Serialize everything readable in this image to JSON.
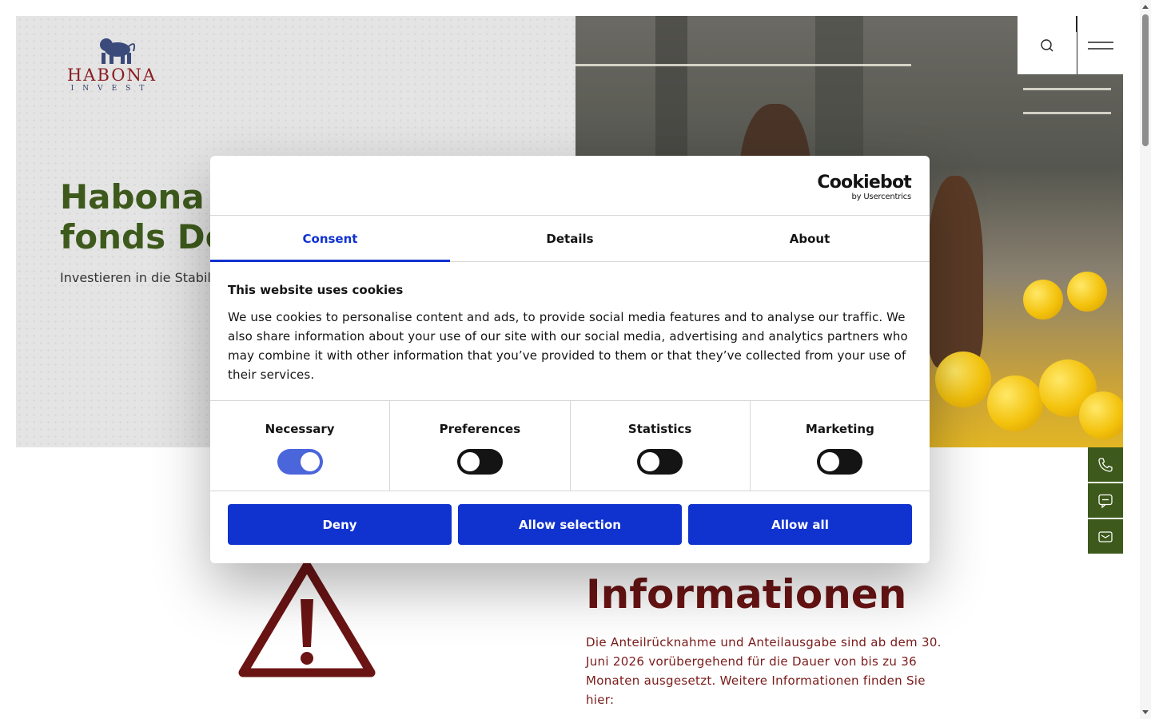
{
  "brand": {
    "logo_word": "HABONA",
    "logo_sub": "INVEST"
  },
  "hero": {
    "title": "Habona N\nfonds De",
    "subtitle": "Investieren in die Stabilit"
  },
  "header": {
    "search_icon": "search-icon",
    "menu_icon": "hamburger-menu-icon"
  },
  "side_actions": [
    {
      "icon": "phone-icon"
    },
    {
      "icon": "chat-icon"
    },
    {
      "icon": "mail-icon"
    }
  ],
  "info": {
    "title_line2": "Informationen",
    "text": "Die Anteilrücknahme und Anteilausgabe sind ab dem 30. Juni 2026 vorübergehend für die Dauer von bis zu 36 Monaten ausgesetzt. Weitere Informationen finden Sie hier:"
  },
  "cookie_dialog": {
    "provider_name": "Cookiebot",
    "provider_by": "by Usercentrics",
    "tabs": [
      {
        "label": "Consent",
        "active": true
      },
      {
        "label": "Details",
        "active": false
      },
      {
        "label": "About",
        "active": false
      }
    ],
    "heading": "This website uses cookies",
    "body": "We use cookies to personalise content and ads, to provide social media features and to analyse our traffic. We also share information about your use of our site with our social media, advertising and analytics partners who may combine it with other information that you’ve provided to them or that they’ve collected from your use of their services.",
    "categories": [
      {
        "label": "Necessary",
        "checked": true
      },
      {
        "label": "Preferences",
        "checked": false
      },
      {
        "label": "Statistics",
        "checked": false
      },
      {
        "label": "Marketing",
        "checked": false
      }
    ],
    "buttons": {
      "deny": "Deny",
      "allow_selection": "Allow selection",
      "allow_all": "Allow all"
    }
  },
  "colors": {
    "accent_blue": "#1032cf",
    "brand_green": "#3d5a1c",
    "brand_red": "#6b1414"
  }
}
